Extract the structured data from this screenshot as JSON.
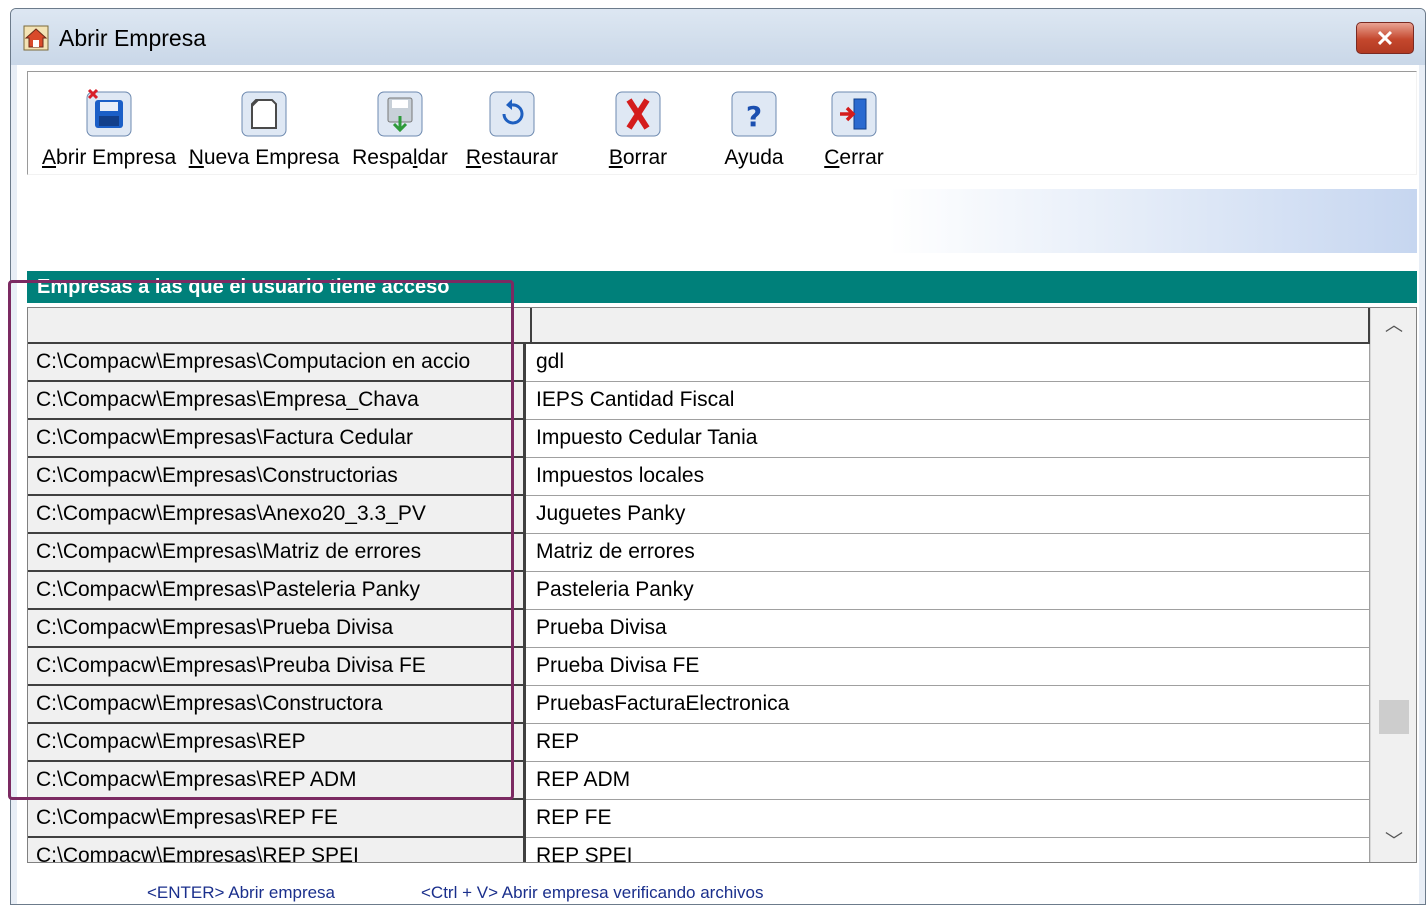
{
  "window": {
    "title": "Abrir Empresa",
    "close_glyph": "✕"
  },
  "toolbar": {
    "buttons": [
      {
        "pre": "",
        "key": "A",
        "post": "brir Empresa",
        "icon": "open-company-icon"
      },
      {
        "pre": "",
        "key": "N",
        "post": "ueva Empresa",
        "icon": "new-company-icon"
      },
      {
        "pre": "Respa",
        "key": "l",
        "post": "dar",
        "icon": "backup-icon"
      },
      {
        "pre": "",
        "key": "R",
        "post": "estaurar",
        "icon": "restore-icon"
      },
      {
        "pre": "",
        "key": "B",
        "post": "orrar",
        "icon": "delete-icon"
      },
      {
        "pre": "Ayuda",
        "key": "",
        "post": "",
        "icon": "help-icon"
      },
      {
        "pre": "",
        "key": "C",
        "post": "errar",
        "icon": "close-door-icon"
      }
    ]
  },
  "section": {
    "title": "Empresas a las que el usuario tiene acceso"
  },
  "grid": {
    "rows": [
      {
        "path": "C:\\Compacw\\Empresas\\Computacion en accio",
        "name": "gdl"
      },
      {
        "path": "C:\\Compacw\\Empresas\\Empresa_Chava",
        "name": "IEPS Cantidad Fiscal"
      },
      {
        "path": "C:\\Compacw\\Empresas\\Factura Cedular",
        "name": "Impuesto Cedular Tania"
      },
      {
        "path": "C:\\Compacw\\Empresas\\Constructorias",
        "name": "Impuestos locales"
      },
      {
        "path": "C:\\Compacw\\Empresas\\Anexo20_3.3_PV",
        "name": "Juguetes Panky"
      },
      {
        "path": "C:\\Compacw\\Empresas\\Matriz de errores",
        "name": "Matriz de errores"
      },
      {
        "path": "C:\\Compacw\\Empresas\\Pasteleria Panky",
        "name": "Pasteleria Panky"
      },
      {
        "path": "C:\\Compacw\\Empresas\\Prueba Divisa",
        "name": "Prueba Divisa"
      },
      {
        "path": "C:\\Compacw\\Empresas\\Preuba Divisa FE",
        "name": "Prueba Divisa FE"
      },
      {
        "path": "C:\\Compacw\\Empresas\\Constructora",
        "name": "PruebasFacturaElectronica"
      },
      {
        "path": "C:\\Compacw\\Empresas\\REP",
        "name": "REP"
      },
      {
        "path": "C:\\Compacw\\Empresas\\REP ADM",
        "name": "REP ADM"
      },
      {
        "path": "C:\\Compacw\\Empresas\\REP FE",
        "name": "REP FE"
      },
      {
        "path": "C:\\Compacw\\Empresas\\REP SPEI",
        "name": "REP SPEI"
      }
    ],
    "scroll_up_glyph": "︿",
    "scroll_down_glyph": "﹀"
  },
  "footer": {
    "hint_enter": "<ENTER> Abrir empresa",
    "hint_ctrl_v": "<Ctrl + V> Abrir empresa verificando archivos"
  },
  "colors": {
    "header_teal": "#00807a",
    "highlight": "#7b2a62",
    "hint_text": "#1a2f8c"
  }
}
